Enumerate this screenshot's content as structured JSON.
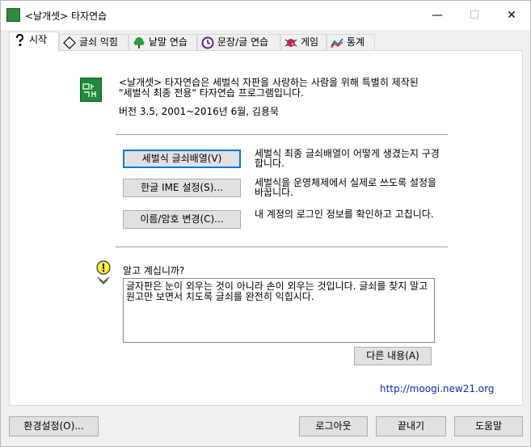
{
  "window": {
    "title": "<날개셋> 타자연습",
    "app_icon_text": "날개셋",
    "minimize": "—",
    "maximize": "☐",
    "close": "✕"
  },
  "tabs": [
    {
      "label": "시작",
      "icon": "question-icon"
    },
    {
      "label": "글쇠 익힘",
      "icon": "diamond-icon"
    },
    {
      "label": "낱말 연습",
      "icon": "tree-icon"
    },
    {
      "label": "문장/글 연습",
      "icon": "clock-icon"
    },
    {
      "label": "게임",
      "icon": "bug-icon"
    },
    {
      "label": "통계",
      "icon": "chart-icon"
    }
  ],
  "main": {
    "logo_text": "날개셋",
    "intro_line1": "<날개셋> 타자연습은 세벌식 자판을 사랑하는 사람을 위해 특별히 제작된",
    "intro_line2": "\"세벌식 최종 전용\" 타자연습 프로그램입니다.",
    "version": "버전 3.5, 2001~2016년 6월, 김용묵",
    "buttons": [
      {
        "label": "세벌식 글쇠배열(V)",
        "desc": "세벌식 최종 글쇠배열이 어떻게 생겼는지 구경합니다."
      },
      {
        "label": "한글 IME 설정(S)...",
        "desc": "세벌식을 운영체제에서 실제로 쓰도록 설정을 바꿉니다."
      },
      {
        "label": "이름/암호 변경(C)...",
        "desc": "내 계정의 로그인 정보를 확인하고 고칩니다."
      }
    ],
    "tip_title": "알고 계십니까?",
    "tip_text": "글자판은 눈이 외우는 것이 아니라 손이 외우는 것입니다. 글쇠를 찾지 말고 원고만 보면서 치도록 글쇠를 완전히 익힙시다.",
    "next_button": "다른 내용(A)",
    "link": "http://moogi.new21.org"
  },
  "footer": {
    "settings_button": "환경설정(O)...",
    "logout_button": "로그아웃",
    "exit_button": "끝내기",
    "help_button": "도움말"
  }
}
